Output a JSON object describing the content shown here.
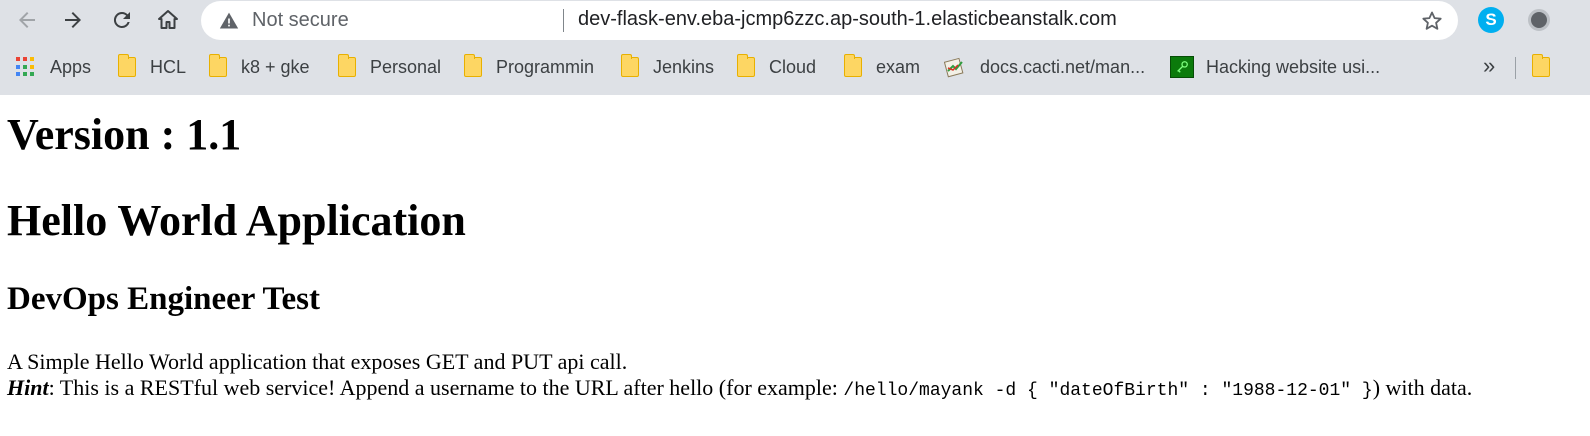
{
  "browser": {
    "security_label": "Not secure",
    "url": "dev-flask-env.eba-jcmp6zzc.ap-south-1.elasticbeanstalk.com",
    "extension_skype_letter": "S"
  },
  "bookmarks": {
    "items": [
      {
        "label": "Apps",
        "icon": "apps-grid-icon"
      },
      {
        "label": "HCL",
        "icon": "folder-icon"
      },
      {
        "label": "k8 + gke",
        "icon": "folder-icon"
      },
      {
        "label": "Personal",
        "icon": "folder-icon"
      },
      {
        "label": "Programmin",
        "icon": "folder-icon"
      },
      {
        "label": "Jenkins",
        "icon": "folder-icon"
      },
      {
        "label": "Cloud",
        "icon": "folder-icon"
      },
      {
        "label": "exam",
        "icon": "folder-icon"
      },
      {
        "label": "docs.cacti.net/man...",
        "icon": "cacti-favicon-icon"
      },
      {
        "label": "Hacking website usi...",
        "icon": "hacking-favicon-icon"
      }
    ],
    "overflow_label": "»"
  },
  "page": {
    "version_heading": "Version : 1.1",
    "app_heading": "Hello World Application",
    "sub_heading": "DevOps Engineer Test",
    "description": "A Simple Hello World application that exposes GET and PUT api call.",
    "hint_label": "Hint",
    "hint_text_1": ": This is a RESTful web service! Append a username to the URL after hello (for example: ",
    "hint_code": "/hello/mayank -d { \"dateOfBirth\" : \"1988-12-01\" }",
    "hint_text_2": ") with data."
  },
  "colors": {
    "chrome_bg": "#dee1e6",
    "omnibox_bg": "#ffffff",
    "folder_fill": "#fdd663",
    "skype_blue": "#00aff0"
  }
}
